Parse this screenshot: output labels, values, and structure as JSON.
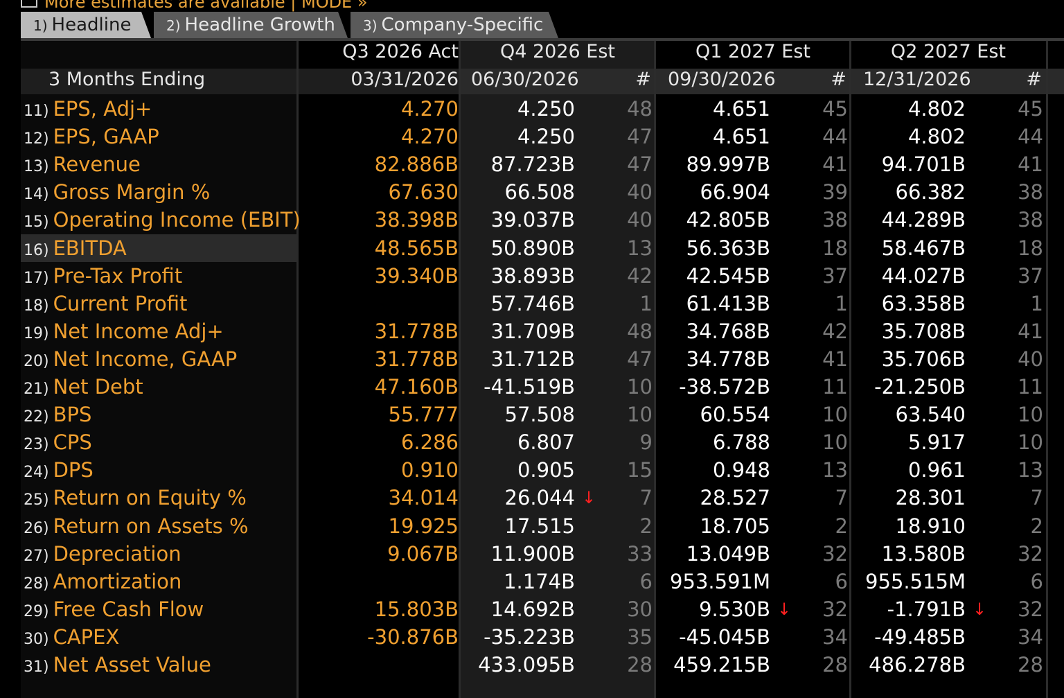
{
  "banner": {
    "text": "More estimates are available | MODE »"
  },
  "tabs": [
    {
      "num": "1)",
      "label": "Headline"
    },
    {
      "num": "2)",
      "label": "Headline Growth"
    },
    {
      "num": "3)",
      "label": "Company-Specific"
    }
  ],
  "header": {
    "row_label": "3 Months Ending",
    "count_symbol": "#",
    "periods": [
      {
        "title": "Q3 2026 Act",
        "date": "03/31/2026"
      },
      {
        "title": "Q4 2026 Est",
        "date": "06/30/2026"
      },
      {
        "title": "Q1 2027 Est",
        "date": "09/30/2026"
      },
      {
        "title": "Q2 2027 Est",
        "date": "12/31/2026"
      }
    ]
  },
  "rows": [
    {
      "num": "11)",
      "label": "EPS, Adj+",
      "act": "4.270",
      "q4": "4.250",
      "q4n": "48",
      "q1": "4.651",
      "q1n": "45",
      "q2": "4.802",
      "q2n": "45"
    },
    {
      "num": "12)",
      "label": "EPS, GAAP",
      "act": "4.270",
      "q4": "4.250",
      "q4n": "47",
      "q1": "4.651",
      "q1n": "44",
      "q2": "4.802",
      "q2n": "44"
    },
    {
      "num": "13)",
      "label": "Revenue",
      "act": "82.886B",
      "q4": "87.723B",
      "q4n": "47",
      "q1": "89.997B",
      "q1n": "41",
      "q2": "94.701B",
      "q2n": "41"
    },
    {
      "num": "14)",
      "label": "Gross Margin %",
      "act": "67.630",
      "q4": "66.508",
      "q4n": "40",
      "q1": "66.904",
      "q1n": "39",
      "q2": "66.382",
      "q2n": "38"
    },
    {
      "num": "15)",
      "label": "Operating Income (EBIT)",
      "act": "38.398B",
      "q4": "39.037B",
      "q4n": "40",
      "q1": "42.805B",
      "q1n": "38",
      "q2": "44.289B",
      "q2n": "38"
    },
    {
      "num": "16)",
      "label": "EBITDA",
      "act": "48.565B",
      "q4": "50.890B",
      "q4n": "13",
      "q1": "56.363B",
      "q1n": "18",
      "q2": "58.467B",
      "q2n": "18",
      "selected": true
    },
    {
      "num": "17)",
      "label": "Pre-Tax Profit",
      "act": "39.340B",
      "q4": "38.893B",
      "q4n": "42",
      "q1": "42.545B",
      "q1n": "37",
      "q2": "44.027B",
      "q2n": "37"
    },
    {
      "num": "18)",
      "label": "Current Profit",
      "act": "",
      "q4": "57.746B",
      "q4n": "1",
      "q1": "61.413B",
      "q1n": "1",
      "q2": "63.358B",
      "q2n": "1"
    },
    {
      "num": "19)",
      "label": "Net Income Adj+",
      "act": "31.778B",
      "q4": "31.709B",
      "q4n": "48",
      "q1": "34.768B",
      "q1n": "42",
      "q2": "35.708B",
      "q2n": "41"
    },
    {
      "num": "20)",
      "label": "Net Income, GAAP",
      "act": "31.778B",
      "q4": "31.712B",
      "q4n": "47",
      "q1": "34.778B",
      "q1n": "41",
      "q2": "35.706B",
      "q2n": "40"
    },
    {
      "num": "21)",
      "label": "Net Debt",
      "act": "47.160B",
      "q4": "-41.519B",
      "q4n": "10",
      "q1": "-38.572B",
      "q1n": "11",
      "q2": "-21.250B",
      "q2n": "11"
    },
    {
      "num": "22)",
      "label": "BPS",
      "act": "55.777",
      "q4": "57.508",
      "q4n": "10",
      "q1": "60.554",
      "q1n": "10",
      "q2": "63.540",
      "q2n": "10"
    },
    {
      "num": "23)",
      "label": "CPS",
      "act": "6.286",
      "q4": "6.807",
      "q4n": "9",
      "q1": "6.788",
      "q1n": "10",
      "q2": "5.917",
      "q2n": "10"
    },
    {
      "num": "24)",
      "label": "DPS",
      "act": "0.910",
      "q4": "0.905",
      "q4n": "15",
      "q1": "0.948",
      "q1n": "13",
      "q2": "0.961",
      "q2n": "13"
    },
    {
      "num": "25)",
      "label": "Return on Equity %",
      "act": "34.014",
      "q4": "26.044",
      "q4n": "7",
      "q1": "28.527",
      "q1n": "7",
      "q2": "28.301",
      "q2n": "7",
      "q4_down": true
    },
    {
      "num": "26)",
      "label": "Return on Assets %",
      "act": "19.925",
      "q4": "17.515",
      "q4n": "2",
      "q1": "18.705",
      "q1n": "2",
      "q2": "18.910",
      "q2n": "2"
    },
    {
      "num": "27)",
      "label": "Depreciation",
      "act": "9.067B",
      "q4": "11.900B",
      "q4n": "33",
      "q1": "13.049B",
      "q1n": "32",
      "q2": "13.580B",
      "q2n": "32"
    },
    {
      "num": "28)",
      "label": "Amortization",
      "act": "",
      "q4": "1.174B",
      "q4n": "6",
      "q1": "953.591M",
      "q1n": "6",
      "q2": "955.515M",
      "q2n": "6"
    },
    {
      "num": "29)",
      "label": "Free Cash Flow",
      "act": "15.803B",
      "q4": "14.692B",
      "q4n": "30",
      "q1": "9.530B",
      "q1n": "32",
      "q2": "-1.791B",
      "q2n": "32",
      "q1_down": true,
      "q2_down": true
    },
    {
      "num": "30)",
      "label": "CAPEX",
      "act": "-30.876B",
      "q4": "-35.223B",
      "q4n": "35",
      "q1": "-45.045B",
      "q1n": "34",
      "q2": "-49.485B",
      "q2n": "34"
    },
    {
      "num": "31)",
      "label": "Net Asset Value",
      "act": "",
      "q4": "433.095B",
      "q4n": "28",
      "q1": "459.215B",
      "q1n": "28",
      "q2": "486.278B",
      "q2n": "28"
    }
  ],
  "arrow_glyph": "↓",
  "colors": {
    "label": "#f0a030",
    "estimate": "#ffffff",
    "count": "#7a7a7a",
    "down_arrow": "#ff2020",
    "selected_row": "#2b2b2b"
  }
}
